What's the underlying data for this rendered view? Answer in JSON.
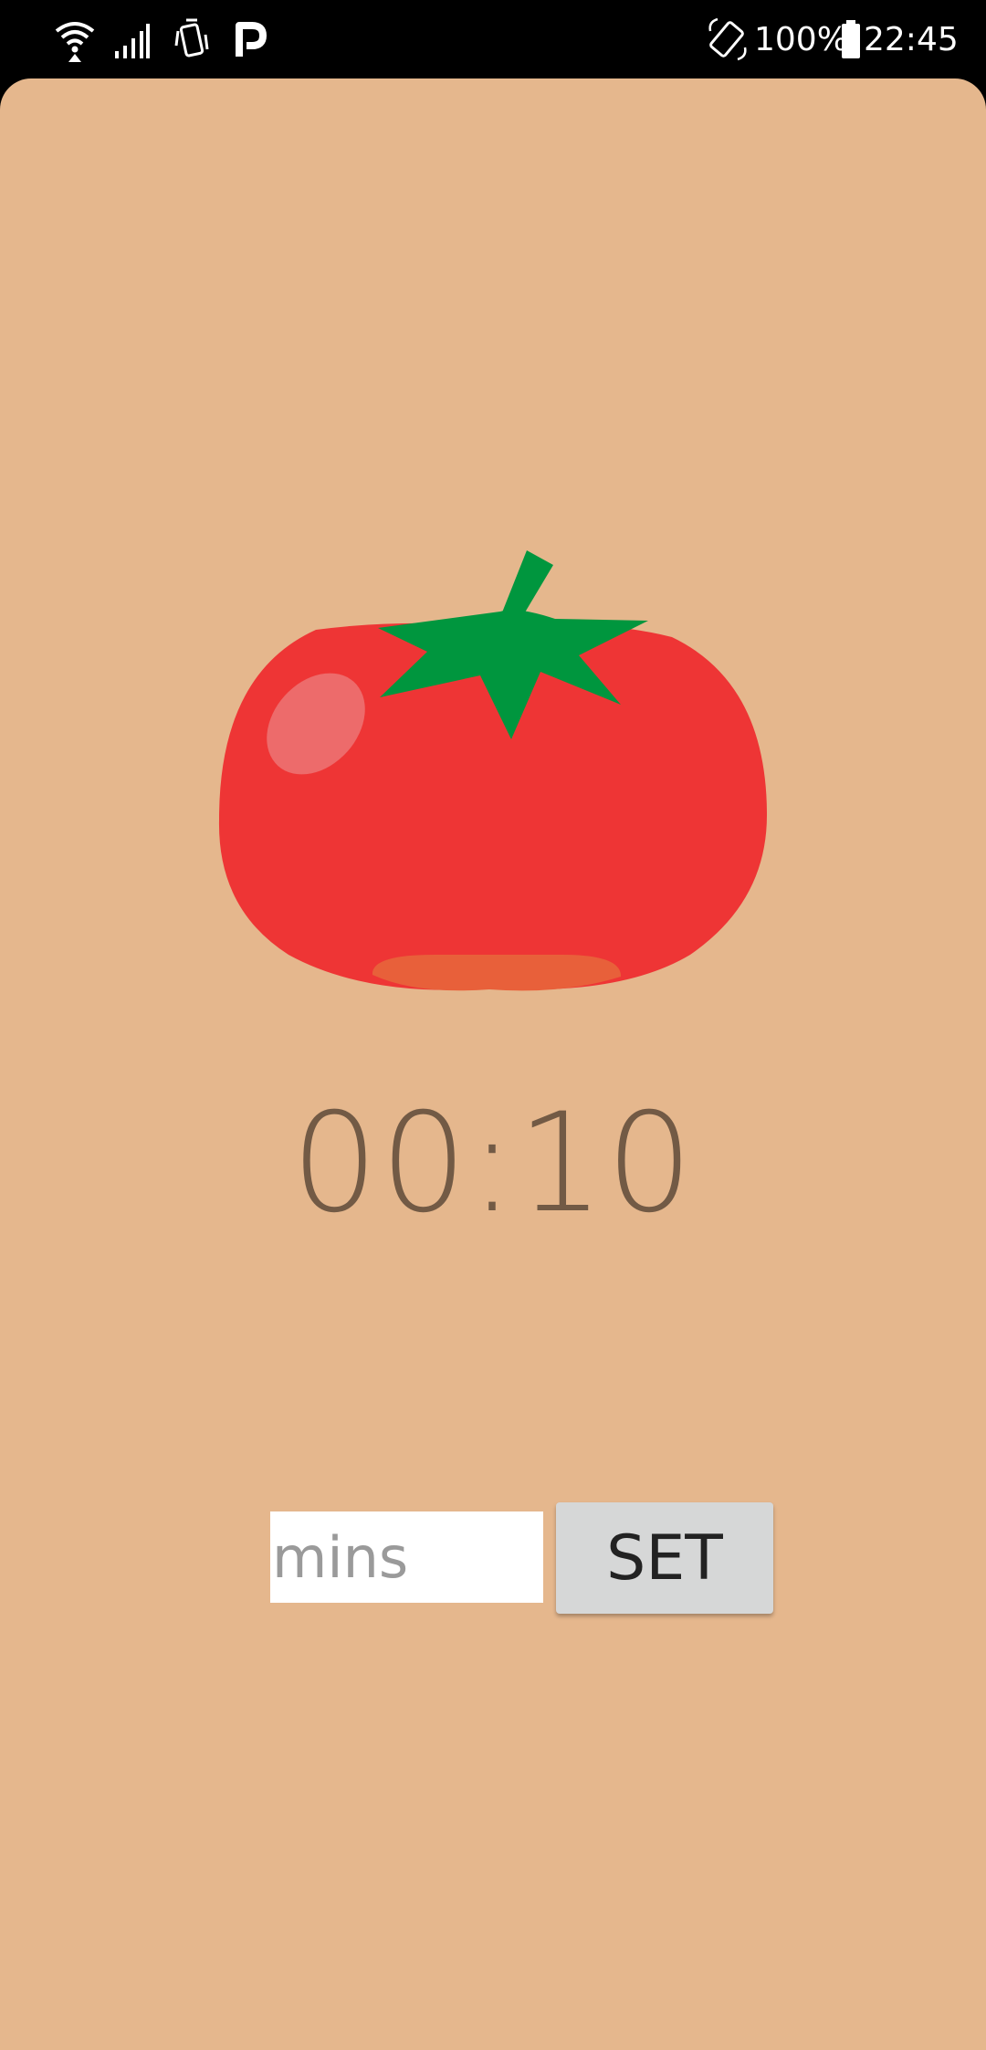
{
  "status_bar": {
    "battery_percent": "100%",
    "time": "22:45",
    "icons": [
      "wifi-icon",
      "cell-signal-icon",
      "vibrate-icon",
      "parking-app-icon",
      "auto-rotate-icon",
      "battery-icon"
    ]
  },
  "timer": {
    "display": "00:10"
  },
  "controls": {
    "minutes_placeholder": "mins",
    "minutes_value": "",
    "set_label": "SET"
  },
  "colors": {
    "background": "#E5B78D",
    "timer_text": "#725A45",
    "tomato_red": "#EE3535",
    "tomato_leaf": "#00963E",
    "button_bg": "#D6D7D7"
  },
  "icons": {
    "main_illustration": "tomato-icon"
  }
}
